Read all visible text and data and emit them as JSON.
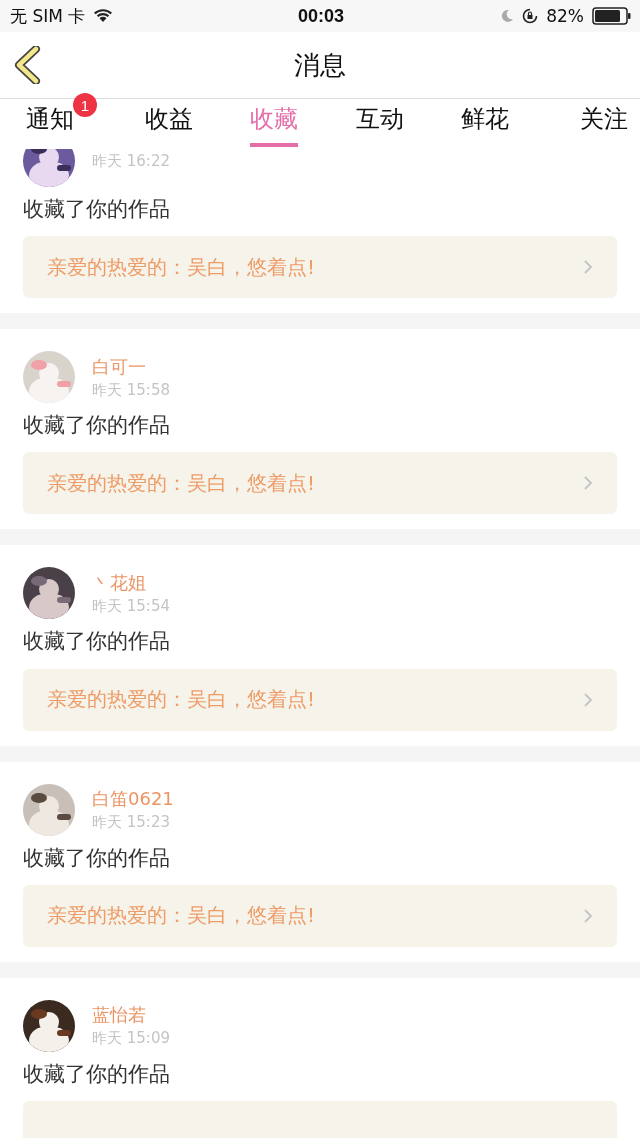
{
  "status_bar": {
    "carrier": "无 SIM 卡",
    "time": "00:03",
    "battery": "82%"
  },
  "nav": {
    "title": "消息"
  },
  "tabs": [
    {
      "label": "通知",
      "selected": false,
      "badge": "1"
    },
    {
      "label": "收益",
      "selected": false
    },
    {
      "label": "收藏",
      "selected": true
    },
    {
      "label": "互动",
      "selected": false
    },
    {
      "label": "鲜花",
      "selected": false
    },
    {
      "label": "关注",
      "selected": false
    }
  ],
  "messages": [
    {
      "time": "昨天 16:22",
      "text": "收藏了你的作品",
      "preview": "亲爱的热爱的：吴白，悠着点!"
    },
    {
      "name": "白可一",
      "time": "昨天 15:58",
      "text": "收藏了你的作品",
      "preview": "亲爱的热爱的：吴白，悠着点!"
    },
    {
      "name": "丶花姐",
      "time": "昨天 15:54",
      "text": "收藏了你的作品",
      "preview": "亲爱的热爱的：吴白，悠着点!"
    },
    {
      "name": "白笛0621",
      "time": "昨天 15:23",
      "text": "收藏了你的作品",
      "preview": "亲爱的热爱的：吴白，悠着点!"
    },
    {
      "name": "蓝怡若",
      "time": "昨天 15:09",
      "text": "收藏了你的作品"
    }
  ]
}
